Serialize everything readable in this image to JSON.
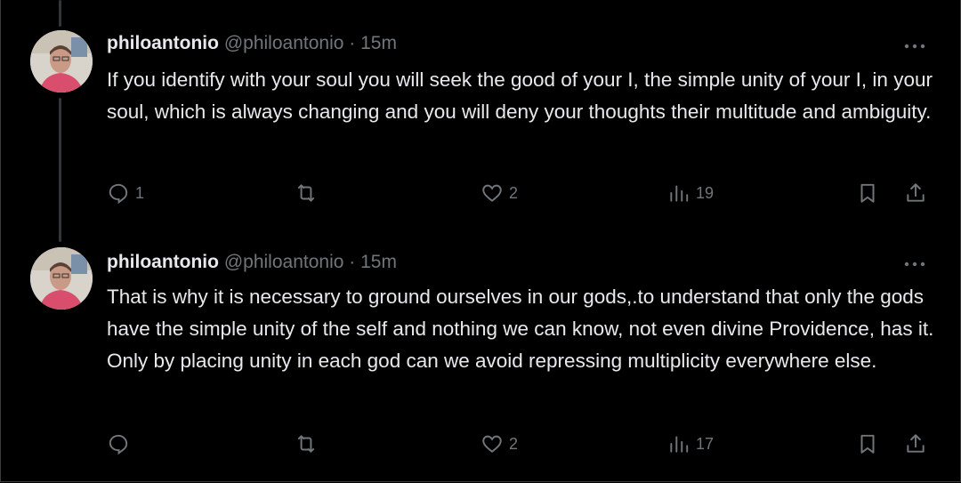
{
  "tweets": [
    {
      "name": "philoantonio",
      "handle": "@philoantonio",
      "separator": "·",
      "time": "15m",
      "text": "If you identify with your soul you will seek the good of your I, the simple unity of your I, in your soul, which is always changing and you will deny your thoughts their multitude and ambiguity.",
      "reply_count": "1",
      "retweet_count": "",
      "like_count": "2",
      "view_count": "19"
    },
    {
      "name": "philoantonio",
      "handle": "@philoantonio",
      "separator": "·",
      "time": "15m",
      "text": "That is why it is necessary to ground ourselves in our gods,.to understand that only the gods have the simple unity of the self and nothing we can know, not even divine Providence, has it. Only by placing unity in each god can we avoid repressing multiplicity everywhere else.",
      "reply_count": "",
      "retweet_count": "",
      "like_count": "2",
      "view_count": "17"
    }
  ],
  "colors": {
    "background": "#000000",
    "text": "#e7e9ea",
    "muted": "#71767b",
    "thread_line": "#333639"
  },
  "icons": [
    "reply-icon",
    "retweet-icon",
    "like-icon",
    "views-icon",
    "bookmark-icon",
    "share-icon",
    "more-icon"
  ]
}
